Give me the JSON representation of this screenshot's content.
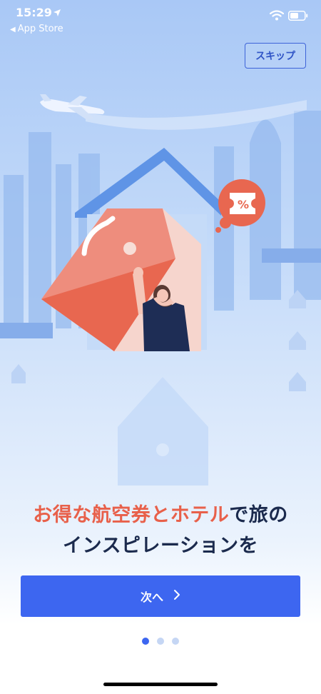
{
  "status_bar": {
    "time": "15:29",
    "back_app": "App Store",
    "icons": [
      "location-arrow-icon",
      "wifi-icon",
      "battery-icon"
    ]
  },
  "header": {
    "skip_label": "スキップ"
  },
  "illustration": {
    "discount_badge": "%",
    "icons": [
      "airplane-icon",
      "house-icon",
      "price-tag-icon",
      "coupon-ticket-icon",
      "person-waving"
    ]
  },
  "headline": {
    "line1_accent_1": "お得な航空券",
    "line1_join": "と",
    "line1_accent_2": "ホテル",
    "line1_rest": "で旅の",
    "line2": "インスピレーションを"
  },
  "cta": {
    "next_label": "次へ",
    "icon": "chevron-right-icon"
  },
  "pagination": {
    "total": 3,
    "current": 1
  },
  "colors": {
    "primary": "#3d66f0",
    "accent": "#e8604a",
    "heading": "#1b2a4d",
    "sky": "#a9c8f6"
  }
}
